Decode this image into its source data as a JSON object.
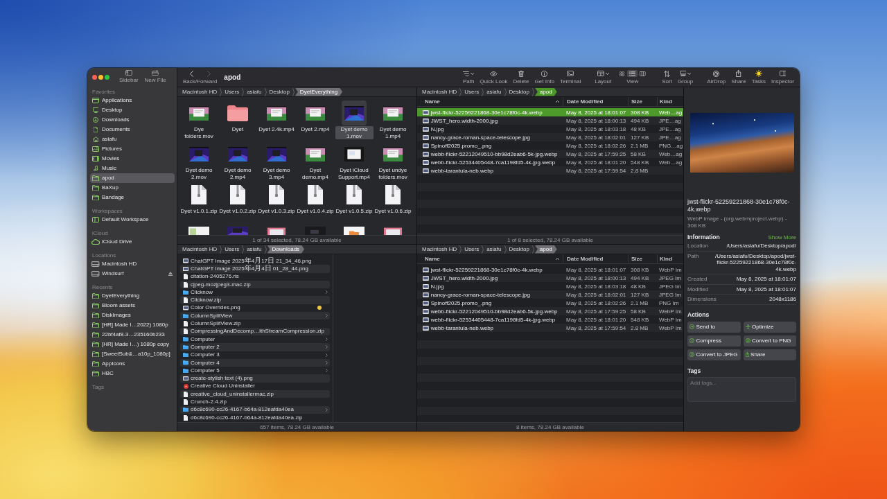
{
  "sidebar": {
    "buttons": [
      {
        "label": "Sidebar"
      },
      {
        "label": "New File"
      }
    ],
    "sections": [
      {
        "title": "Favorites",
        "items": [
          {
            "label": "Applications",
            "selected": false
          },
          {
            "label": "Desktop",
            "selected": false
          },
          {
            "label": "Downloads",
            "selected": false
          },
          {
            "label": "Documents",
            "selected": false
          },
          {
            "label": "asiafu",
            "selected": false
          },
          {
            "label": "Pictures",
            "selected": false
          },
          {
            "label": "Movies",
            "selected": false
          },
          {
            "label": "Music",
            "selected": false
          },
          {
            "label": "apod",
            "selected": true
          },
          {
            "label": "BaXup",
            "selected": false
          },
          {
            "label": "Bandage",
            "selected": false
          }
        ]
      },
      {
        "title": "Workspaces",
        "items": [
          {
            "label": "Default Workspace",
            "selected": false
          }
        ]
      },
      {
        "title": "iCloud",
        "items": [
          {
            "label": "iCloud Drive",
            "selected": false
          }
        ]
      },
      {
        "title": "Locations",
        "items": [
          {
            "label": "Macintosh HD",
            "selected": false,
            "ejectable": false
          },
          {
            "label": "Windsurf",
            "selected": false,
            "ejectable": true
          }
        ]
      },
      {
        "title": "Recents",
        "items": [
          {
            "label": "DyetEverything",
            "selected": false
          },
          {
            "label": "Bloom assets",
            "selected": false
          },
          {
            "label": "DiskImages",
            "selected": false
          },
          {
            "label": "[HR] Made I…2022) 1080p",
            "selected": false
          },
          {
            "label": "22bf4af8-3…235160b233",
            "selected": false
          },
          {
            "label": "[HR] Made I…) 1080p copy",
            "selected": false
          },
          {
            "label": "[SweetSub&…a10p_1080p]",
            "selected": false
          },
          {
            "label": "AppIcons",
            "selected": false
          },
          {
            "label": "HBC",
            "selected": false
          }
        ]
      },
      {
        "title": "Tags"
      }
    ]
  },
  "toolbar": {
    "nav": [
      {
        "disabled": false
      },
      {
        "disabled": true
      }
    ],
    "nav_label": "Back/Forward",
    "title": "apod",
    "tools": [
      {
        "label": "Path",
        "menu": true
      },
      {
        "label": "Quick Look",
        "menu": false
      },
      {
        "label": "Delete",
        "menu": false
      },
      {
        "label": "Get Info",
        "menu": false
      },
      {
        "label": "Terminal",
        "menu": false
      },
      {
        "label": "Layout",
        "menu": true
      }
    ],
    "view": {
      "label": "View",
      "options": [
        {
          "selected": false
        },
        {
          "selected": true
        },
        {
          "selected": false
        }
      ]
    },
    "tools_right": [
      {
        "label": "Sort",
        "menu": false
      },
      {
        "label": "Group",
        "menu": true
      },
      {
        "label": "AirDrop",
        "menu": false
      },
      {
        "label": "Share",
        "menu": false
      },
      {
        "label": "Tasks",
        "menu": false
      },
      {
        "label": "Inspector",
        "menu": false
      }
    ]
  },
  "panes": [
    {
      "kind": "icons",
      "focused": false,
      "path": [
        {
          "label": "Macintosh HD",
          "selected": false
        },
        {
          "label": "Users",
          "selected": false
        },
        {
          "label": "asiafu",
          "selected": false
        },
        {
          "label": "Desktop",
          "selected": false
        },
        {
          "label": "DyetEverything",
          "selected": true
        }
      ],
      "items": [
        {
          "label": "Dye folders.mov",
          "kind": "video",
          "selected": false
        },
        {
          "label": "Dyet",
          "kind": "folder",
          "selected": false
        },
        {
          "label": "Dyet 2.4k.mp4",
          "kind": "video",
          "selected": false
        },
        {
          "label": "Dyet 2.mp4",
          "kind": "video",
          "selected": false
        },
        {
          "label": "Dyet demo 1.mov",
          "kind": "video",
          "selected": true
        },
        {
          "label": "Dyet demo 1.mp4",
          "kind": "video",
          "selected": false
        },
        {
          "label": "Dyet demo 2.mov",
          "kind": "video",
          "selected": false
        },
        {
          "label": "Dyet demo 2.mp4",
          "kind": "video",
          "selected": false
        },
        {
          "label": "Dyet demo 3.mp4",
          "kind": "video",
          "selected": false
        },
        {
          "label": "Dyet demo.mp4",
          "kind": "video",
          "selected": false
        },
        {
          "label": "Dyet iCloud Support.mp4",
          "kind": "video",
          "selected": false
        },
        {
          "label": "Dyet undye folders.mov",
          "kind": "video",
          "selected": false
        },
        {
          "label": "Dyet v1.0.1.zip",
          "kind": "zip",
          "selected": false
        },
        {
          "label": "Dyet v1.0.2.zip",
          "kind": "zip",
          "selected": false
        },
        {
          "label": "Dyet v1.0.3.zip",
          "kind": "zip",
          "selected": false
        },
        {
          "label": "Dyet v1.0.4.zip",
          "kind": "zip",
          "selected": false
        },
        {
          "label": "Dyet v1.0.5.zip",
          "kind": "zip",
          "selected": false
        },
        {
          "label": "Dyet v1.0.6.zip",
          "kind": "zip",
          "selected": false
        }
      ],
      "clipped_items": [
        {
          "kind": "image"
        },
        {
          "kind": "video"
        },
        {
          "kind": "image"
        },
        {
          "kind": "video"
        },
        {
          "kind": "image"
        },
        {
          "kind": "image"
        }
      ],
      "status": "1 of 34 selected, 78.24 GB available"
    },
    {
      "kind": "list",
      "focused": true,
      "path": [
        {
          "label": "Macintosh HD",
          "selected": false
        },
        {
          "label": "Users",
          "selected": false
        },
        {
          "label": "asiafu",
          "selected": false
        },
        {
          "label": "Desktop",
          "selected": false
        },
        {
          "label": "apod",
          "selected": true
        }
      ],
      "columns": [
        {
          "label": "Name",
          "sorted": true
        },
        {
          "label": "Date Modified",
          "sorted": false
        },
        {
          "label": "Size",
          "sorted": false
        },
        {
          "label": "Kind",
          "sorted": false
        }
      ],
      "rows": [
        {
          "cells": [
            "jwst-flickr-52259221868-30e1c78f0c-4k.webp",
            "May 8, 2025 at 18:01:07",
            "308 KB",
            "Web…ag"
          ],
          "selected": true
        },
        {
          "cells": [
            "JWST_hero.width-2000.jpg",
            "May 8, 2025 at 18:00:13",
            "494 KB",
            "JPE…ag"
          ],
          "selected": false
        },
        {
          "cells": [
            "N.jpg",
            "May 8, 2025 at 18:03:18",
            "48 KB",
            "JPE…ag"
          ],
          "selected": false
        },
        {
          "cells": [
            "nancy-grace-roman-space-telescope.jpg",
            "May 8, 2025 at 18:02:01",
            "127 KB",
            "JPE…ag"
          ],
          "selected": false
        },
        {
          "cells": [
            "Spinoff2025.promo_.png",
            "May 8, 2025 at 18:02:26",
            "2.1 MB",
            "PNG…ag"
          ],
          "selected": false
        },
        {
          "cells": [
            "webb-flickr-52212049510-bb98d2eab6-5k-jpg.webp",
            "May 8, 2025 at 17:59:25",
            "58 KB",
            "Web…ag"
          ],
          "selected": false
        },
        {
          "cells": [
            "webb-flickr-52534405448-7ca1198fd5-4k-jpg.webp",
            "May 8, 2025 at 18:01:20",
            "548 KB",
            "Web…ag"
          ],
          "selected": false
        },
        {
          "cells": [
            "webb-tarantula-neb.webp",
            "May 8, 2025 at 17:59:54",
            "2.8 MB"
          ],
          "selected": false
        }
      ],
      "status": "1 of 8 selected, 78.24 GB available"
    },
    {
      "kind": "columns",
      "focused": false,
      "path": [
        {
          "label": "Macintosh HD",
          "selected": false
        },
        {
          "label": "Users",
          "selected": false
        },
        {
          "label": "asiafu",
          "selected": false
        },
        {
          "label": "Downloads",
          "selected": true
        }
      ],
      "items": [
        {
          "label": "ChatGPT Image 2025年4月17日 21_34_46.png",
          "kind": "image"
        },
        {
          "label": "ChatGPT Image 2025年4月4日 01_28_44.png",
          "kind": "image"
        },
        {
          "label": "citation-2405276.ris",
          "kind": "file"
        },
        {
          "label": "cjpeg-mozjpeg3-mac.zip",
          "kind": "file"
        },
        {
          "label": "Clicknow",
          "kind": "folder"
        },
        {
          "label": "Clicknow.zip",
          "kind": "file"
        },
        {
          "label": "Color Overrides.png",
          "kind": "image",
          "color": "#f2c744"
        },
        {
          "label": "ColumnSplitView",
          "kind": "folder"
        },
        {
          "label": "ColumnSplitView.zip",
          "kind": "file"
        },
        {
          "label": "CompressingAndDecomp…ithStreamCompression.zip",
          "kind": "file"
        },
        {
          "label": "Computer",
          "kind": "folder"
        },
        {
          "label": "Computer 2",
          "kind": "folder"
        },
        {
          "label": "Computer 3",
          "kind": "folder"
        },
        {
          "label": "Computer 4",
          "kind": "folder"
        },
        {
          "label": "Computer 5",
          "kind": "folder"
        },
        {
          "label": "create-stylish text (4).png",
          "kind": "image"
        },
        {
          "label": "Creative Cloud Uninstaller",
          "kind": "app"
        },
        {
          "label": "creative_cloud_uninstallermac.zip",
          "kind": "file"
        },
        {
          "label": "Crunch-2.4.zip",
          "kind": "file"
        },
        {
          "label": "d6c8c690-cc26-4167-b64a-812eafda40ea",
          "kind": "folder"
        },
        {
          "label": "d6c8c690-cc26-4167-b64a-812eafda40ea.zip",
          "kind": "file"
        }
      ],
      "status": "657 items, 78.24 GB available"
    },
    {
      "kind": "list",
      "focused": false,
      "path": [
        {
          "label": "Macintosh HD",
          "selected": false
        },
        {
          "label": "Users",
          "selected": false
        },
        {
          "label": "asiafu",
          "selected": false
        },
        {
          "label": "Desktop",
          "selected": false
        },
        {
          "label": "apod",
          "selected": true
        }
      ],
      "columns": [
        {
          "label": "Name",
          "sorted": true
        },
        {
          "label": "Date Modified",
          "sorted": false
        },
        {
          "label": "Size",
          "sorted": false
        },
        {
          "label": "Kind",
          "sorted": false
        }
      ],
      "rows": [
        {
          "cells": [
            "jwst-flickr-52259221868-30e1c78f0c-4k.webp",
            "May 8, 2025 at 18:01:07",
            "308 KB",
            "WebP Im"
          ],
          "selected": false
        },
        {
          "cells": [
            "JWST_hero.width-2000.jpg",
            "May 8, 2025 at 18:00:13",
            "494 KB",
            "JPEG Im"
          ],
          "selected": false
        },
        {
          "cells": [
            "N.jpg",
            "May 8, 2025 at 18:03:18",
            "48 KB",
            "JPEG Im"
          ],
          "selected": false
        },
        {
          "cells": [
            "nancy-grace-roman-space-telescope.jpg",
            "May 8, 2025 at 18:02:01",
            "127 KB",
            "JPEG Im"
          ],
          "selected": false
        },
        {
          "cells": [
            "Spinoff2025.promo_.png",
            "May 8, 2025 at 18:02:26",
            "2.1 MB",
            "PNG Im"
          ],
          "selected": false
        },
        {
          "cells": [
            "webb-flickr-52212049510-bb98d2eab6-5k-jpg.webp",
            "May 8, 2025 at 17:59:25",
            "58 KB",
            "WebP Im"
          ],
          "selected": false
        },
        {
          "cells": [
            "webb-flickr-52534405448-7ca1198fd5-4k-jpg.webp",
            "May 8, 2025 at 18:01:20",
            "548 KB",
            "WebP Im"
          ],
          "selected": false
        },
        {
          "cells": [
            "webb-tarantula-neb.webp",
            "May 8, 2025 at 17:59:54",
            "2.8 MB",
            "WebP Im"
          ],
          "selected": false
        }
      ],
      "status": "8 items, 78.24 GB available"
    }
  ],
  "inspector": {
    "name": "jwst-flickr-52259221868-30e1c78f0c-4k.webp",
    "description": "WebP image - (org.webmproject.webp) - 308 KB",
    "information": {
      "title": "Information",
      "link": "Show More",
      "rows": [
        {
          "label": "Location",
          "value": "/Users/asiafu/Desktop/apod/"
        },
        {
          "label": "Path",
          "value": "/Users/asiafu/Desktop/apod/jwst-flickr-52259221868-30e1c78f0c-4k.webp"
        },
        {
          "label": "Created",
          "value": "May 8, 2025 at 18:01:07"
        },
        {
          "label": "Modified",
          "value": "May 8, 2025 at 18:01:07"
        },
        {
          "label": "Dimensions",
          "value": "2048x1186"
        }
      ]
    },
    "actions": {
      "title": "Actions",
      "buttons": [
        {
          "label": "Send to"
        },
        {
          "label": "Optimize"
        },
        {
          "label": "Compress"
        },
        {
          "label": "Convert to PNG"
        },
        {
          "label": "Convert to JPEG"
        },
        {
          "label": "Share"
        }
      ]
    },
    "tags": {
      "title": "Tags",
      "placeholder": "Add tags..."
    }
  }
}
